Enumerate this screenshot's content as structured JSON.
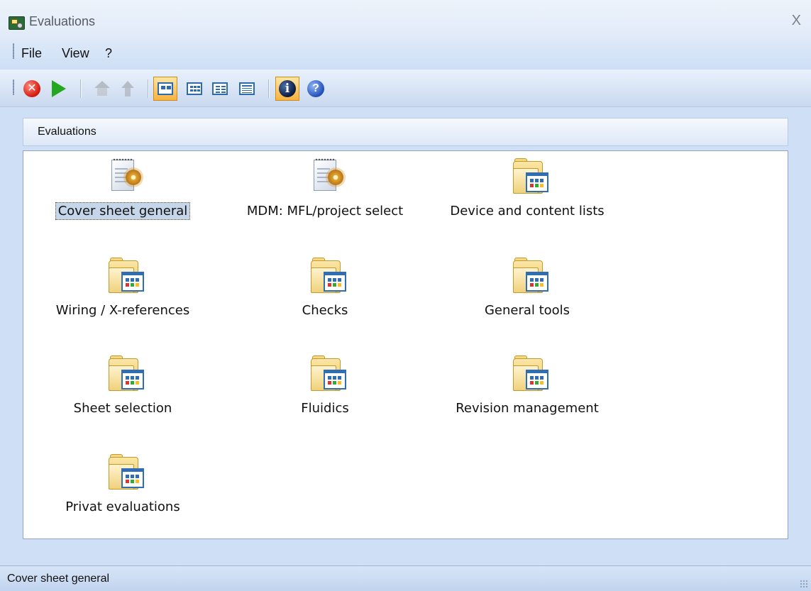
{
  "window": {
    "title": "Evaluations",
    "close_label": "X"
  },
  "menu": {
    "items": [
      "File",
      "View",
      "?"
    ]
  },
  "toolbar": {
    "buttons": [
      {
        "name": "stop",
        "icon": "stop-icon"
      },
      {
        "name": "run",
        "icon": "play-icon"
      },
      {
        "name": "home",
        "icon": "home-icon",
        "enabled": false
      },
      {
        "name": "up",
        "icon": "up-icon",
        "enabled": false
      },
      {
        "name": "large-icons-view",
        "icon": "large-icons-view-icon",
        "active": true
      },
      {
        "name": "small-icons-view",
        "icon": "small-icons-view-icon"
      },
      {
        "name": "list-view",
        "icon": "list-view-icon"
      },
      {
        "name": "details-view",
        "icon": "details-view-icon"
      },
      {
        "name": "info",
        "icon": "info-icon",
        "active": true
      },
      {
        "name": "help",
        "icon": "help-icon"
      }
    ]
  },
  "panel": {
    "header": "Evaluations"
  },
  "items": [
    {
      "label": "Cover sheet general",
      "icon": "document-gear-icon",
      "selected": true
    },
    {
      "label": "MDM: MFL/project select",
      "icon": "document-gear-icon"
    },
    {
      "label": "Device and content lists",
      "icon": "folder-icon"
    },
    {
      "label": "Wiring / X-references",
      "icon": "folder-icon"
    },
    {
      "label": "Checks",
      "icon": "folder-icon"
    },
    {
      "label": "General tools",
      "icon": "folder-icon"
    },
    {
      "label": "Sheet selection",
      "icon": "folder-icon"
    },
    {
      "label": "Fluidics",
      "icon": "folder-icon"
    },
    {
      "label": "Revision management",
      "icon": "folder-icon"
    },
    {
      "label": "Privat evaluations",
      "icon": "folder-icon"
    }
  ],
  "status": {
    "text": "Cover sheet general"
  },
  "colors": {
    "accent": "#2f6db5",
    "active_button": "#f8b33e",
    "background": "#cfe0f6"
  }
}
